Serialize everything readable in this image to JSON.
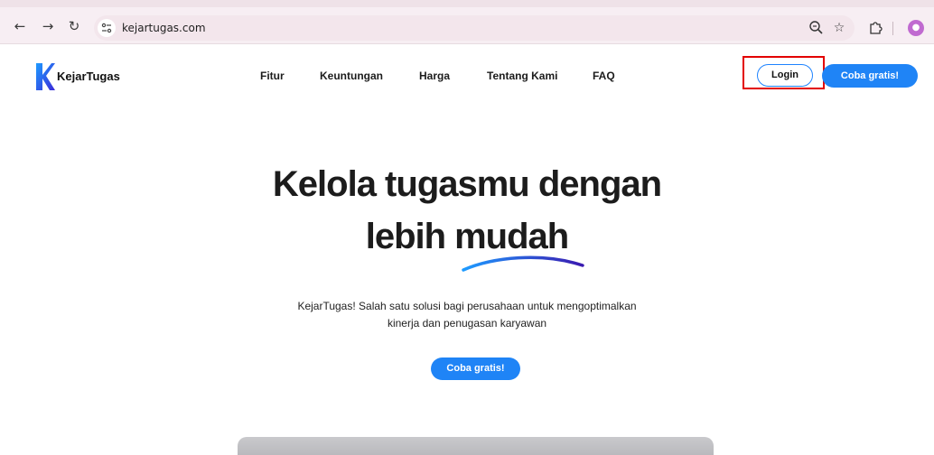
{
  "browser": {
    "back_icon": "arrow-left-icon",
    "forward_icon": "arrow-right-icon",
    "reload_icon": "reload-icon",
    "site_info_icon": "tune-icon",
    "url": "kejartugas.com",
    "zoom_icon": "zoom-icon",
    "bookmark_icon": "star-icon",
    "extensions_icon": "puzzle-icon",
    "profile_icon": "avatar-icon"
  },
  "header": {
    "brand": "KejarTugas",
    "nav": [
      {
        "label": "Fitur"
      },
      {
        "label": "Keuntungan"
      },
      {
        "label": "Harga"
      },
      {
        "label": "Tentang Kami"
      },
      {
        "label": "FAQ"
      }
    ],
    "login_label": "Login",
    "cta_label": "Coba gratis!"
  },
  "hero": {
    "title_line1": "Kelola tugasmu dengan",
    "title_line2_a": "lebih",
    "title_line2_b": "mudah",
    "description_line1": "KejarTugas! Salah satu solusi bagi perusahaan untuk mengoptimalkan",
    "description_line2": "kinerja dan penugasan karyawan",
    "cta_label": "Coba gratis!"
  },
  "colors": {
    "accent": "#1f84f6",
    "highlight_box": "#e30000",
    "browser_bar": "#f7eef3"
  }
}
